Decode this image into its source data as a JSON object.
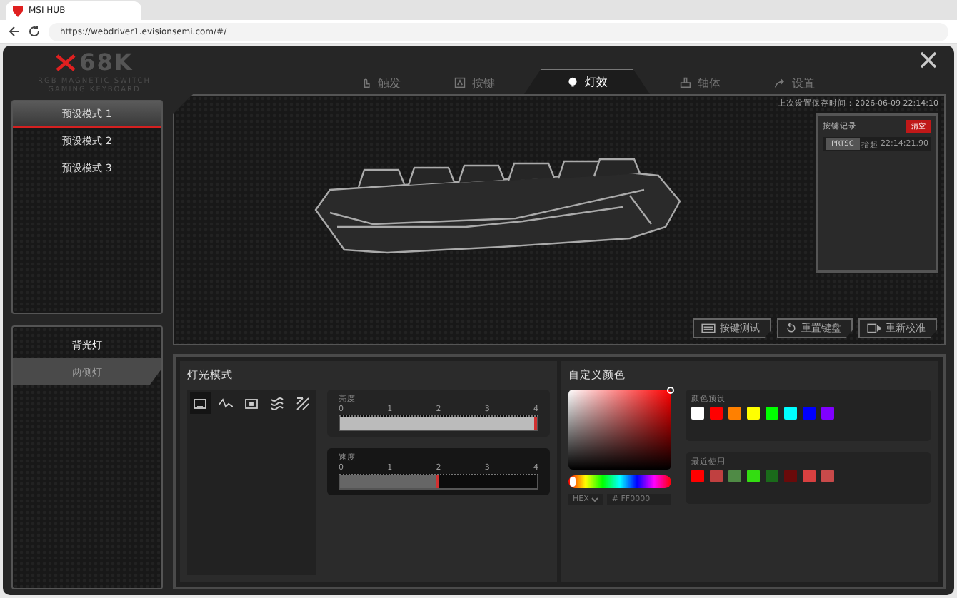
{
  "browser": {
    "tab_title": "MSI HUB",
    "url": "https://webdriver1.evisionsemi.com/#/"
  },
  "logo": {
    "brand": "68K",
    "subtitle": "RGB MAGNETIC SWITCH GAMING KEYBOARD"
  },
  "nav_tabs": [
    {
      "label": "触发",
      "selected": false
    },
    {
      "label": "按键",
      "selected": false
    },
    {
      "label": "灯效",
      "selected": true
    },
    {
      "label": "轴体",
      "selected": false
    },
    {
      "label": "设置",
      "selected": false
    }
  ],
  "presets": [
    {
      "label": "预设模式 1",
      "selected": true
    },
    {
      "label": "预设模式 2",
      "selected": false
    },
    {
      "label": "预设模式 3",
      "selected": false
    }
  ],
  "light_targets": [
    {
      "label": "背光灯",
      "selected": false
    },
    {
      "label": "两侧灯",
      "selected": true
    }
  ],
  "last_saved": "上次设置保存时间：2026-06-09 22:14:10",
  "key_log": {
    "title": "按键记录",
    "clear": "清空",
    "rows": [
      {
        "key": "PRTSC",
        "action": "抬起",
        "time": "22:14:21.90"
      }
    ]
  },
  "actions": [
    {
      "label": "按键测试"
    },
    {
      "label": "重置键盘"
    },
    {
      "label": "重新校准"
    }
  ],
  "light_mode": {
    "title": "灯光模式",
    "modes": [
      {
        "selected": true
      },
      {
        "selected": false
      },
      {
        "selected": false
      },
      {
        "selected": false
      },
      {
        "selected": false
      }
    ],
    "sliders": [
      {
        "label": "亮度",
        "ticks": [
          "0",
          "1",
          "2",
          "3",
          "4"
        ],
        "level": 1.0,
        "active": true
      },
      {
        "label": "速度",
        "ticks": [
          "0",
          "1",
          "2",
          "3",
          "4"
        ],
        "level": 0.5,
        "active": false
      }
    ]
  },
  "custom_color": {
    "title": "自定义颜色",
    "hue": {
      "level": 0
    },
    "format": "HEX",
    "hex": "# FF0000",
    "presets_title": "颜色预设",
    "presets": [
      {
        "color": "#ffffff"
      },
      {
        "color": "#ff0000"
      },
      {
        "color": "#ff8000"
      },
      {
        "color": "#ffff00"
      },
      {
        "color": "#00ff00"
      },
      {
        "color": "#00ffff"
      },
      {
        "color": "#0000ff"
      },
      {
        "color": "#8000ff"
      }
    ],
    "recent_title": "最近使用",
    "recent": [
      {
        "color": "#ff0000"
      },
      {
        "color": "#c04040"
      },
      {
        "color": "#4f8a45"
      },
      {
        "color": "#33dd11"
      },
      {
        "color": "#1a6a1a"
      },
      {
        "color": "#6a0a0a"
      },
      {
        "color": "#d84040"
      },
      {
        "color": "#c84a4a"
      }
    ]
  }
}
